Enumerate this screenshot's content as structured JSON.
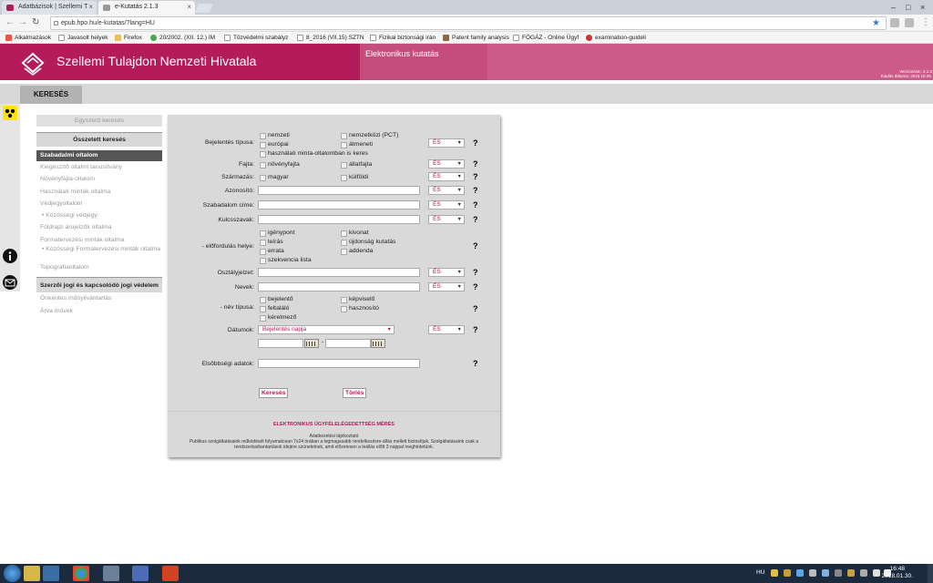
{
  "browser": {
    "tabs": [
      {
        "label": "Adatbázisok | Szellemi T"
      },
      {
        "label": "e-Kutatás 2.1.3"
      }
    ],
    "url": "epub.hpo.hu/e-kutatas/?lang=HU",
    "bookmarks": [
      "Alkalmazások",
      "Javasolt helyek",
      "Firefox",
      "20/2002. (XII. 12.) IM",
      "Tűzvédelmi szabályz",
      "8_2016 (VII.15) SZTN",
      "Fizikai biztonsági irán",
      "Patent family analysis",
      "FÖGÁZ - Online Ügyf",
      "examination-guideli"
    ]
  },
  "header": {
    "title": "Szellemi Tulajdon Nemzeti Hivatala",
    "section": "Elektronikus kutatás",
    "version_line1": "Verziószám: 2.1.3",
    "version_line2": "Kiadás dátuma: 2015.10.26."
  },
  "nav": {
    "tab": "KERESÉS"
  },
  "sidebar": {
    "simple": "Egyszerű keresés",
    "complex": "Összetett keresés",
    "items": [
      "Szabadalmi oltalom",
      "Kiegészítő oltalmi tanúsítvány",
      "Növényfajta-oltalom",
      "Használati minták oltalma",
      "Védjegyoltalom",
      "• Közösségi védjegy",
      "Földrajzi árujelzők oltalma",
      "Formatervezési minták oltalma",
      "• Közösségi Formatervezési minták oltalma",
      "Topográfiaoltalom"
    ],
    "section2": "Szerzői jogi és kapcsolódó jogi védelem",
    "items2": [
      "Önkéntes műnyilvántartás",
      "Árva művek"
    ]
  },
  "form": {
    "labels": {
      "bejelentes_tipusa": "Bejelentés típusa:",
      "fajta": "Fajta:",
      "szarmazas": "Származás:",
      "azonosito": "Azonosító:",
      "szabadalom_cime": "Szabadalom címe:",
      "kulcsszavak": "Kulcsszavak:",
      "elofordulas_helye": "- előfordulás helye:",
      "osztalyjelzet": "Osztályjelzet:",
      "nevek": "Nevek:",
      "nev_tipusa": "- név típusa:",
      "datumok": "Dátumok:",
      "elsobbsegi": "Elsőbbségi adatok:"
    },
    "checkboxes": {
      "tipus": [
        "nemzeti",
        "nemzetközi (PCT)",
        "európai",
        "átmeneti",
        "használati minta-oltalomban is keres"
      ],
      "fajta": [
        "növényfajta",
        "állatfajta"
      ],
      "szarmazas": [
        "magyar",
        "külföldi"
      ],
      "elofordulas": [
        "igénypont",
        "kivonat",
        "leírás",
        "újdonság kutatás",
        "errata",
        "addenda",
        "szekvencia lista"
      ],
      "nevtipus": [
        "bejelentő",
        "képviselő",
        "feltaláló",
        "hasznosító",
        "kérelmező"
      ]
    },
    "op": "ÉS",
    "help": "?",
    "date_select": "Bejelentés napja",
    "date_sep": "-",
    "buttons": {
      "search": "Keresés",
      "clear": "Törlés"
    },
    "footer_link": "ELEKTRONIKUS ÜGYFÉLELÉGEDETTSÉG MÉRÉS",
    "footer_title": "Adatkezelési tájékoztató",
    "footer_text": "Publikus szolgáltatásaink működését folyamatosan 7x24 órában a legmagasabb rendelkezésre-állás mellett biztosítjuk. Szolgáltatásaink csak a rendszerkarbantartások idejére szünetelnek, amit előzetesen a leállás előtt 3 nappal meghirdetünk."
  },
  "taskbar": {
    "lang": "HU",
    "time": "16:48",
    "date": "2018.01.30."
  }
}
